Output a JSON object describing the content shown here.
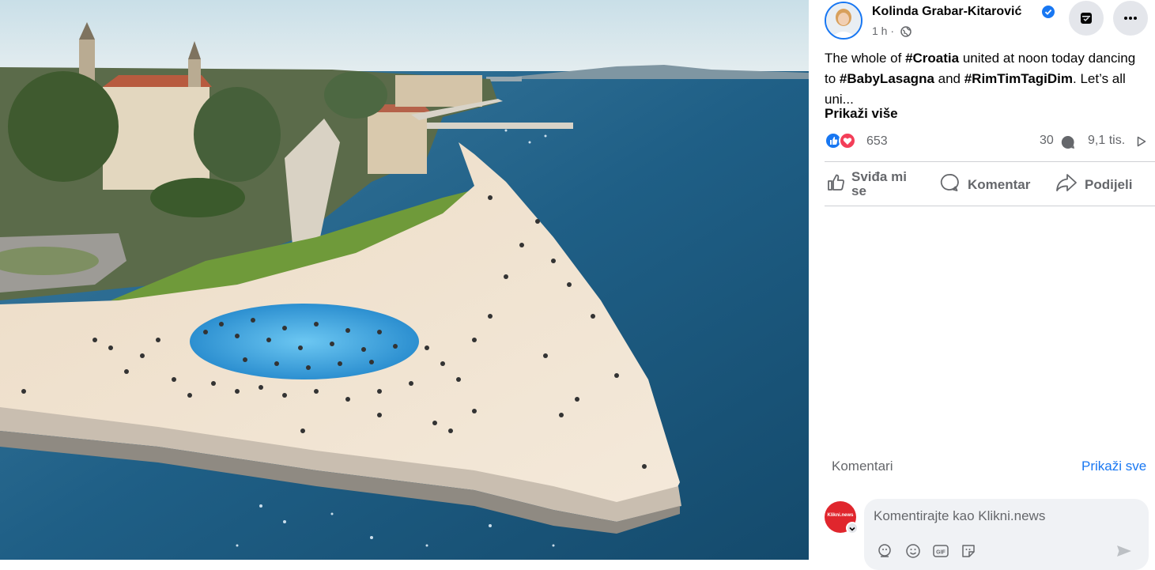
{
  "post": {
    "author": "Kolinda Grabar-Kitarović",
    "time": "1 h",
    "time_sep": "·",
    "text_1": "The whole of ",
    "tag_1": "#Croatia",
    "text_2": " united at noon today dancing to ",
    "tag_2": "#BabyLasagna",
    "text_3": " and ",
    "tag_3": "#RimTimTagiDim",
    "text_4": ". Let’s all uni...",
    "see_more": "Prikaži više"
  },
  "stats": {
    "reactions": "653",
    "comments": "30",
    "views": "9,1 tis."
  },
  "actions": {
    "like": "Sviđa mi",
    "like_2": "se",
    "comment": "Komentar",
    "share": "Podijeli"
  },
  "comments": {
    "label": "Komentari",
    "show_all": "Prikaži sve",
    "placeholder": "Komentirajte kao Klikni.news",
    "avatar_text": "Klikni.news"
  },
  "colors": {
    "accent": "#1877f2",
    "love": "#f33e58",
    "secondary_text": "#65676b"
  }
}
